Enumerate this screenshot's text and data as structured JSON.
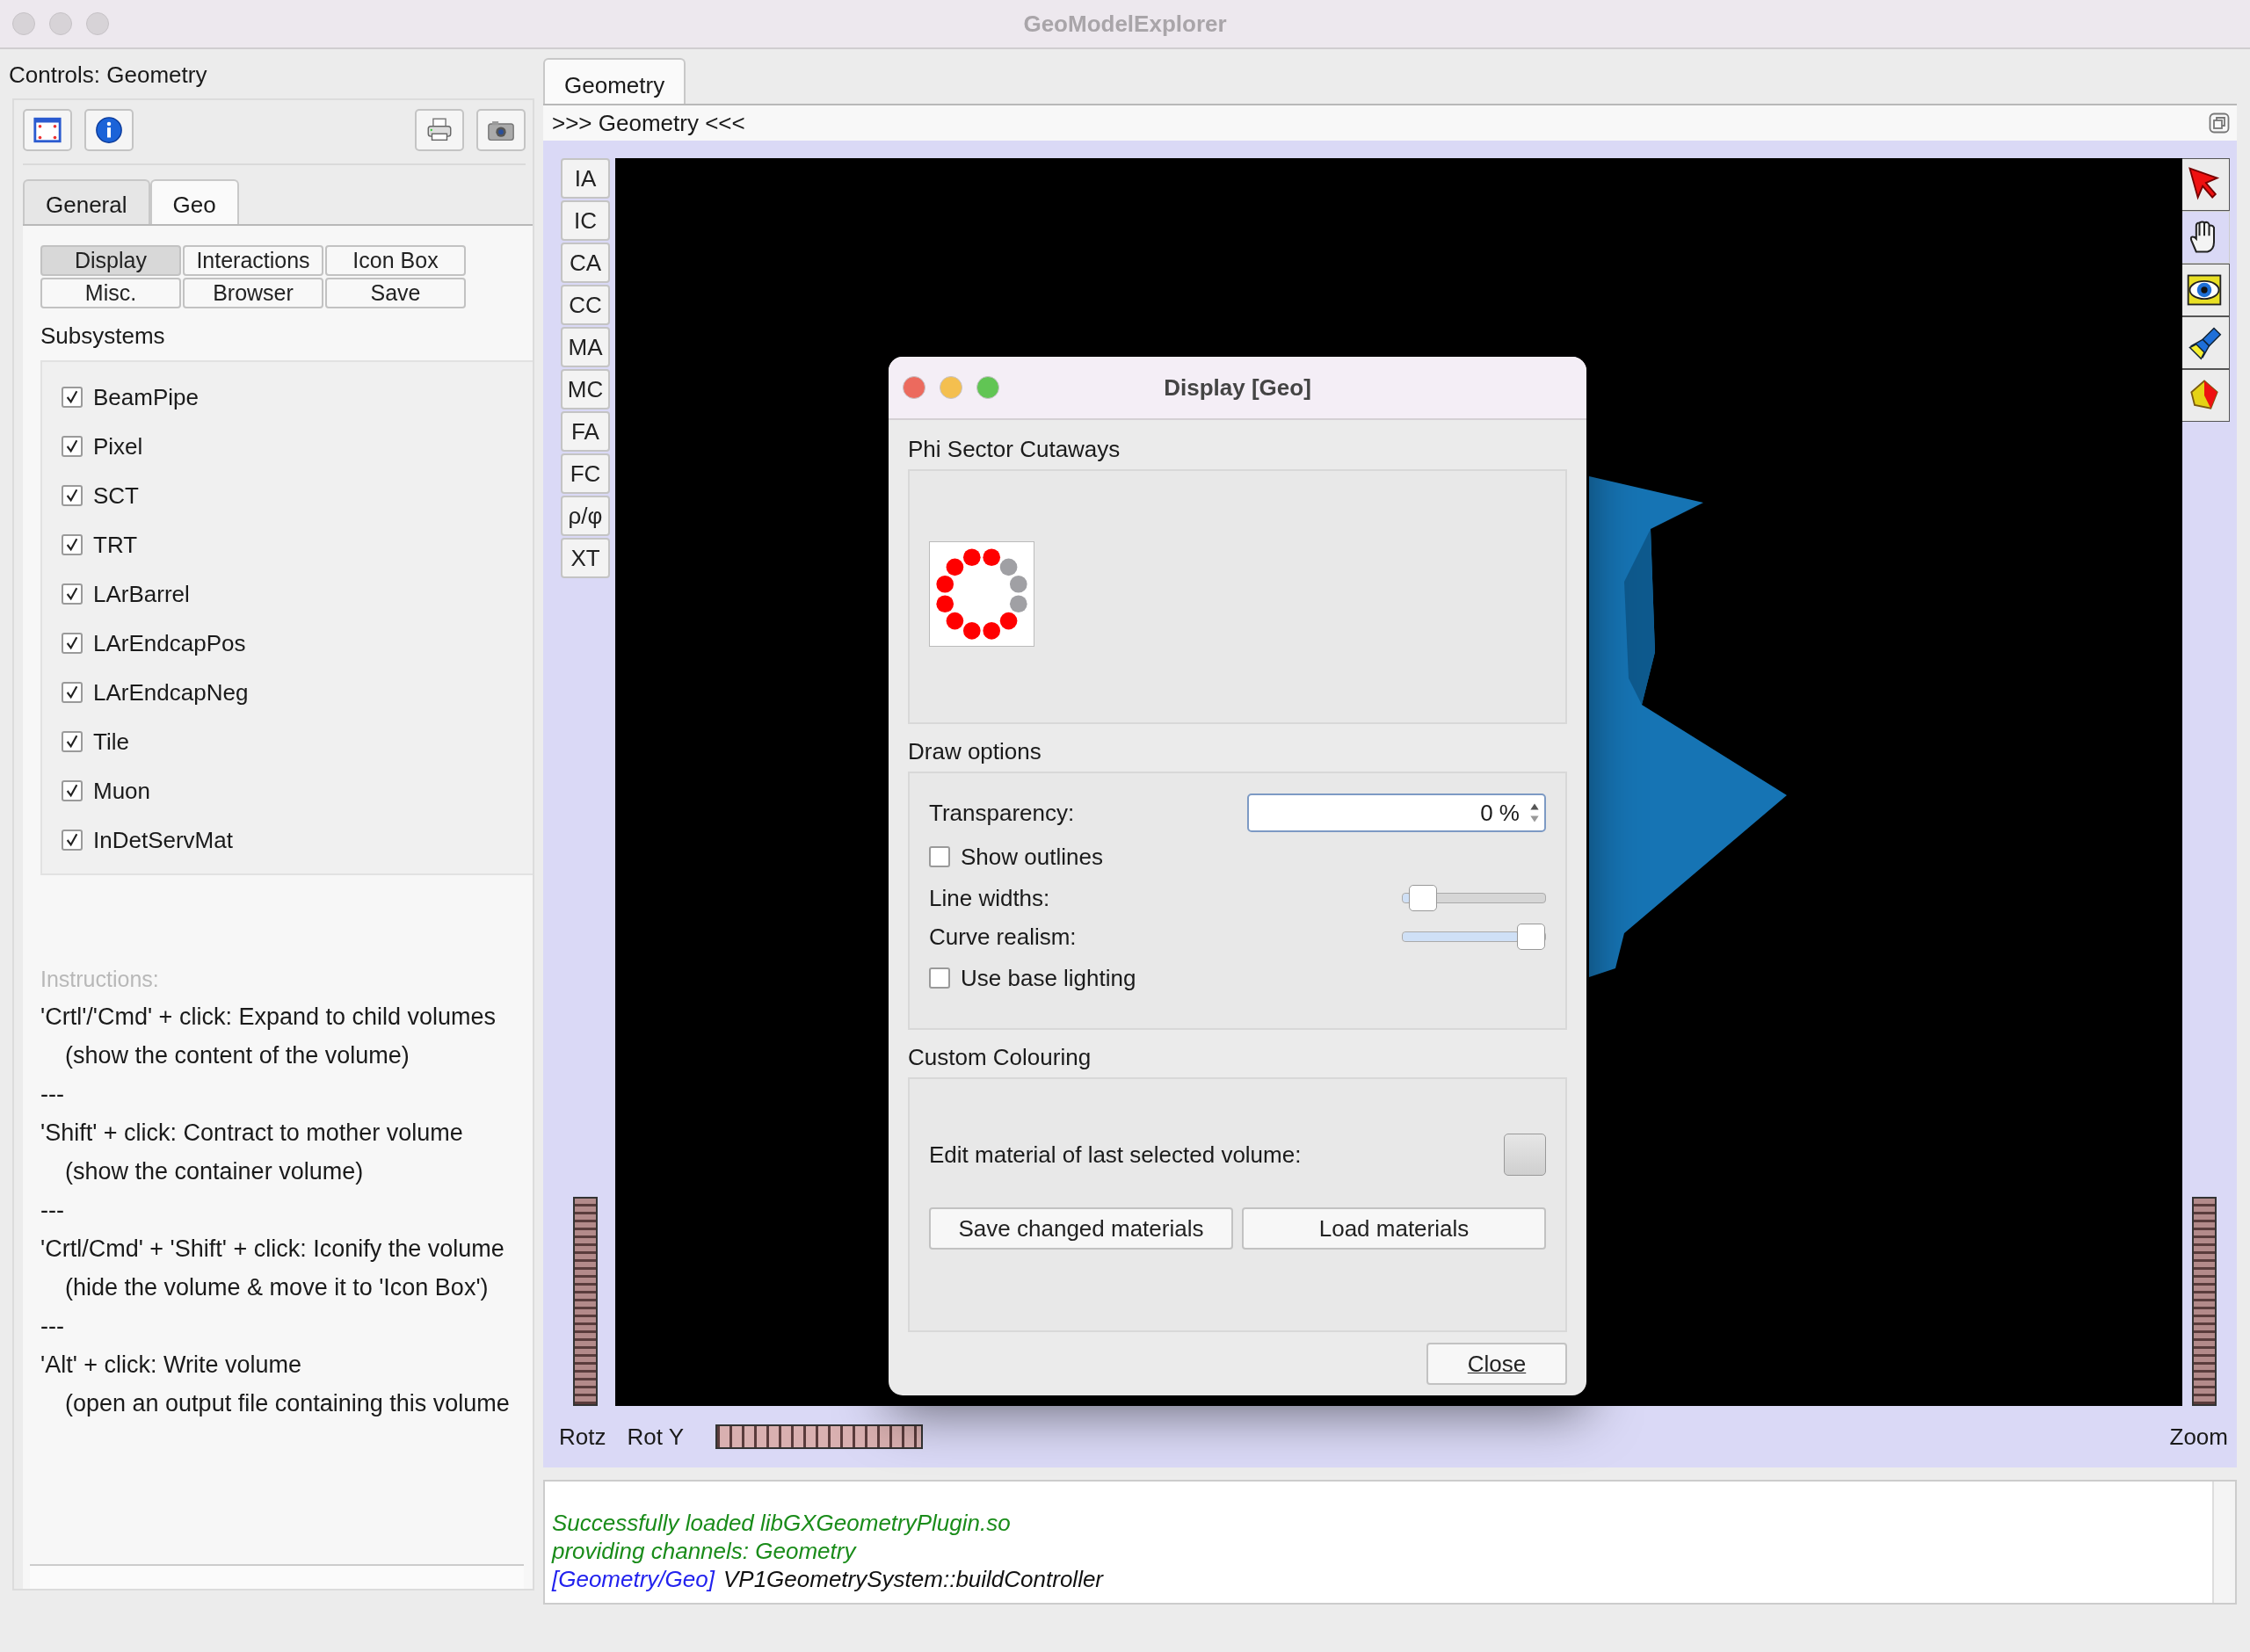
{
  "window": {
    "title": "GeoModelExplorer"
  },
  "left_panel": {
    "title": "Controls: Geometry",
    "tabs": [
      {
        "label": "General",
        "selected": false
      },
      {
        "label": "Geo",
        "selected": true
      }
    ],
    "buttons": [
      {
        "label": "Display",
        "selected": true
      },
      {
        "label": "Interactions",
        "selected": false
      },
      {
        "label": "Icon Box",
        "selected": false
      },
      {
        "label": "Misc.",
        "selected": false
      },
      {
        "label": "Browser",
        "selected": false
      },
      {
        "label": "Save",
        "selected": false
      }
    ],
    "subsystems_heading": "Subsystems",
    "subsystems": [
      {
        "label": "BeamPipe",
        "checked": true
      },
      {
        "label": "Pixel",
        "checked": true
      },
      {
        "label": "SCT",
        "checked": true
      },
      {
        "label": "TRT",
        "checked": true
      },
      {
        "label": "LArBarrel",
        "checked": true
      },
      {
        "label": "LArEndcapPos",
        "checked": true
      },
      {
        "label": "LArEndcapNeg",
        "checked": true
      },
      {
        "label": "Tile",
        "checked": true
      },
      {
        "label": "Muon",
        "checked": true
      },
      {
        "label": "InDetServMat",
        "checked": true
      }
    ],
    "instructions_heading": "Instructions:",
    "instructions": [
      {
        "kind": "main",
        "text": "'Crtl'/'Cmd' + click: Expand to child volumes"
      },
      {
        "kind": "indent",
        "text": "(show the content of the volume)"
      },
      {
        "kind": "main",
        "text": "---"
      },
      {
        "kind": "main",
        "text": "'Shift' + click: Contract to mother volume"
      },
      {
        "kind": "indent",
        "text": "(show the container volume)"
      },
      {
        "kind": "main",
        "text": "---"
      },
      {
        "kind": "main",
        "text": "'Crtl/Cmd' + 'Shift' + click: Iconify the volume"
      },
      {
        "kind": "indent",
        "text": "(hide the volume & move it to 'Icon Box')"
      },
      {
        "kind": "main",
        "text": "---"
      },
      {
        "kind": "main",
        "text": "'Alt' + click: Write volume"
      },
      {
        "kind": "indent",
        "text": "(open an output file containing this volume"
      }
    ]
  },
  "viewer": {
    "tabs": [
      {
        "label": "Geometry",
        "selected": true
      }
    ],
    "header": ">>> Geometry <<<",
    "side_buttons": [
      {
        "label": "IA"
      },
      {
        "label": "IC"
      },
      {
        "label": "CA"
      },
      {
        "label": "CC"
      },
      {
        "label": "MA"
      },
      {
        "label": "MC"
      },
      {
        "label": "FA"
      },
      {
        "label": "FC"
      },
      {
        "label": "ρ/φ"
      },
      {
        "label": "XT"
      }
    ],
    "tools": [
      {
        "kind": "pick",
        "selected": false
      },
      {
        "kind": "pan",
        "selected": true
      },
      {
        "kind": "view",
        "selected": false
      },
      {
        "kind": "light",
        "selected": false
      },
      {
        "kind": "shape",
        "selected": false
      }
    ],
    "bottom_labels": [
      "Rotz",
      "Rot Y"
    ],
    "zoom_label": "Zoom"
  },
  "log": [
    {
      "kind": "success",
      "text": "Successfully loaded libGXGeometryPlugin.so"
    },
    {
      "kind": "success",
      "text": "providing channels: Geometry"
    },
    {
      "kind": "system",
      "source": "[Geometry/Geo]",
      "text": "VP1GeometrySystem::buildController"
    }
  ],
  "dialog": {
    "title": "Display [Geo]",
    "phi_heading": "Phi Sector Cutaways",
    "phi_sectors": [
      {
        "on": true
      },
      {
        "on": false
      },
      {
        "on": false
      },
      {
        "on": false
      },
      {
        "on": true
      },
      {
        "on": true
      },
      {
        "on": true
      },
      {
        "on": true
      },
      {
        "on": true
      },
      {
        "on": true
      },
      {
        "on": true
      },
      {
        "on": true
      }
    ],
    "draw_heading": "Draw options",
    "transparency": {
      "label": "Transparency:",
      "value": "0 %"
    },
    "options": [
      {
        "kind": "checkbox",
        "label": "Show outlines",
        "checked": false
      },
      {
        "kind": "slider",
        "label": "Line widths:",
        "level": 0.05
      },
      {
        "kind": "slider",
        "label": "Curve realism:",
        "level": 1
      },
      {
        "kind": "checkbox",
        "label": "Use base lighting",
        "checked": false
      }
    ],
    "colour_heading": "Custom Colouring",
    "material_label": "Edit material of last selected volume:",
    "material_buttons": [
      "Save changed materials",
      "Load materials"
    ],
    "close": "Close"
  }
}
